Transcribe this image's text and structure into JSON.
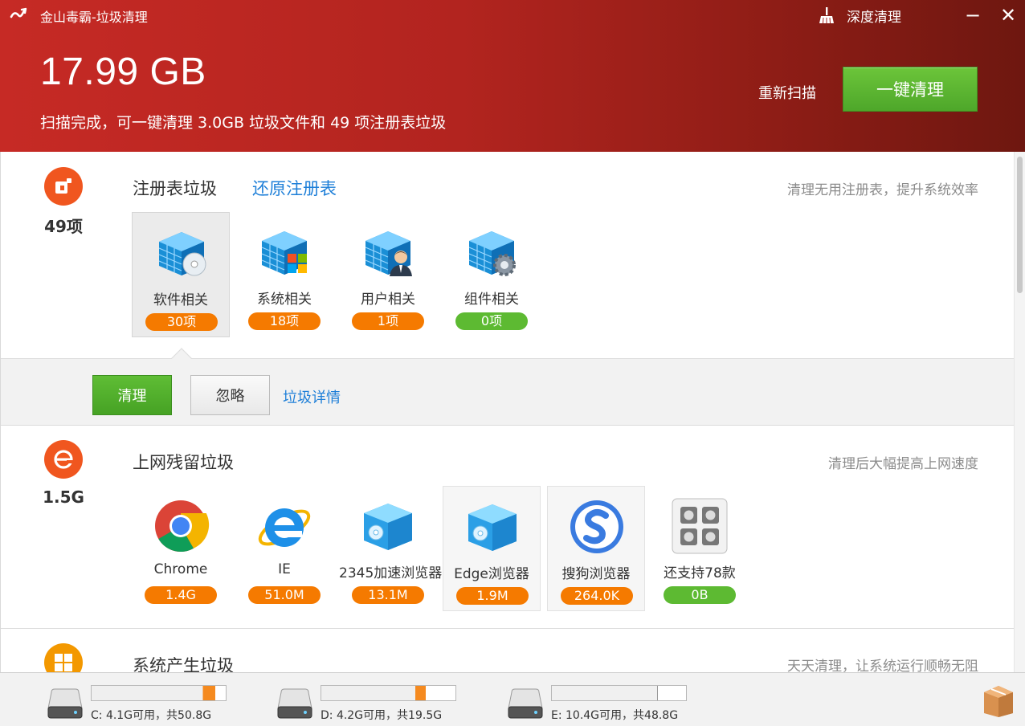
{
  "header": {
    "app_title": "金山毒霸-垃圾清理",
    "deep_clean_label": "深度清理",
    "minimize_glyph": "−",
    "close_glyph": "✕",
    "total_size": "17.99 GB",
    "summary": "扫描完成，可一键清理 3.0GB 垃圾文件和 49 项注册表垃圾",
    "rescan_label": "重新扫描",
    "one_click_label": "一键清理",
    "accent_color": "#c62a25",
    "button_green": "#5dba32"
  },
  "registry": {
    "count": "49项",
    "title": "注册表垃圾",
    "restore_link": "还原注册表",
    "hint": "清理无用注册表，提升系统效率",
    "items": [
      {
        "label": "软件相关",
        "badge": "30项",
        "icon": "registry-cd-icon",
        "state": "selected"
      },
      {
        "label": "系统相关",
        "badge": "18项",
        "icon": "registry-windows-icon",
        "state": "normal"
      },
      {
        "label": "用户相关",
        "badge": "1项",
        "icon": "registry-user-icon",
        "state": "normal"
      },
      {
        "label": "组件相关",
        "badge": "0项",
        "icon": "registry-gear-icon",
        "state": "normal"
      }
    ],
    "actions": {
      "clean_label": "清理",
      "ignore_label": "忽略",
      "detail_link": "垃圾详情"
    }
  },
  "web": {
    "count": "1.5G",
    "title": "上网残留垃圾",
    "hint": "清理后大幅提高上网速度",
    "items": [
      {
        "label": "Chrome",
        "badge": "1.4G",
        "icon": "chrome-icon",
        "state": "normal"
      },
      {
        "label": "IE",
        "badge": "51.0M",
        "icon": "ie-icon",
        "state": "normal"
      },
      {
        "label": "2345加速浏览器",
        "badge": "13.1M",
        "icon": "browser-cube-icon",
        "state": "normal"
      },
      {
        "label": "Edge浏览器",
        "badge": "1.9M",
        "icon": "browser-cube-icon",
        "state": "hovered"
      },
      {
        "label": "搜狗浏览器",
        "badge": "264.0K",
        "icon": "sogou-icon",
        "state": "hovered"
      },
      {
        "label": "还支持78款",
        "badge": "0B",
        "icon": "more-browsers-icon",
        "state": "normal"
      }
    ]
  },
  "system": {
    "title": "系统产生垃圾",
    "hint": "天天清理，让系统运行顺畅无阻"
  },
  "drives": [
    {
      "label": "C: 4.1G可用，共50.8G",
      "used_fraction": 0.92,
      "warn": true
    },
    {
      "label": "D: 4.2G可用，共19.5G",
      "used_fraction": 0.78,
      "warn": true
    },
    {
      "label": "E: 10.4G可用，共48.8G",
      "used_fraction": 0.79,
      "warn": false
    }
  ]
}
